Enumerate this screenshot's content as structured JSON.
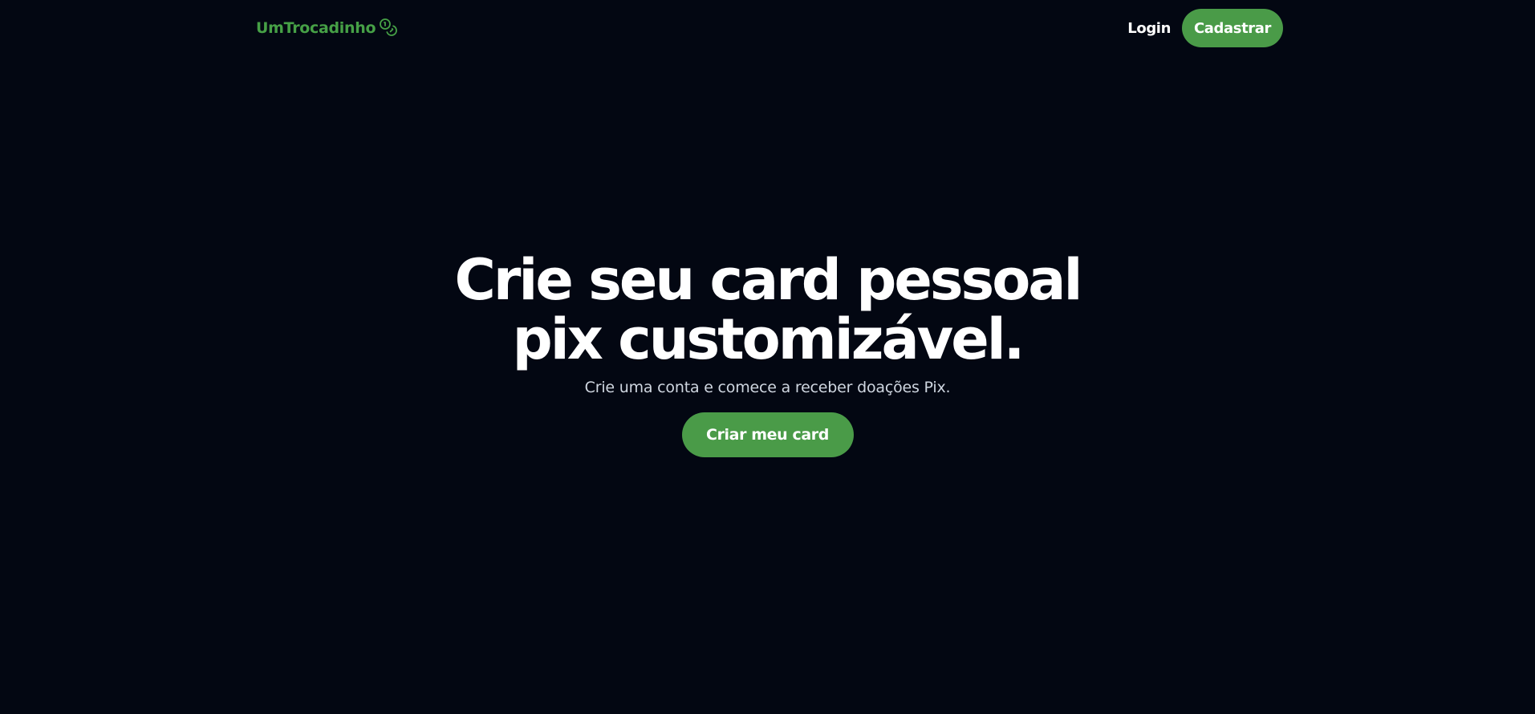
{
  "header": {
    "brand_name": "UmTrocadinho",
    "brand_icon": "coins-icon",
    "login_label": "Login",
    "signup_label": "Cadastrar"
  },
  "hero": {
    "title_line_1": "Crie seu card pessoal",
    "title_line_2": "pix customizável.",
    "subtitle": "Crie uma conta e comece a receber doações Pix.",
    "cta_label": "Criar meu card"
  },
  "colors": {
    "background": "#030712",
    "accent": "#4a9b48",
    "brand_text": "#46a046",
    "text_primary": "#ffffff",
    "text_secondary": "#cfd6e0"
  }
}
